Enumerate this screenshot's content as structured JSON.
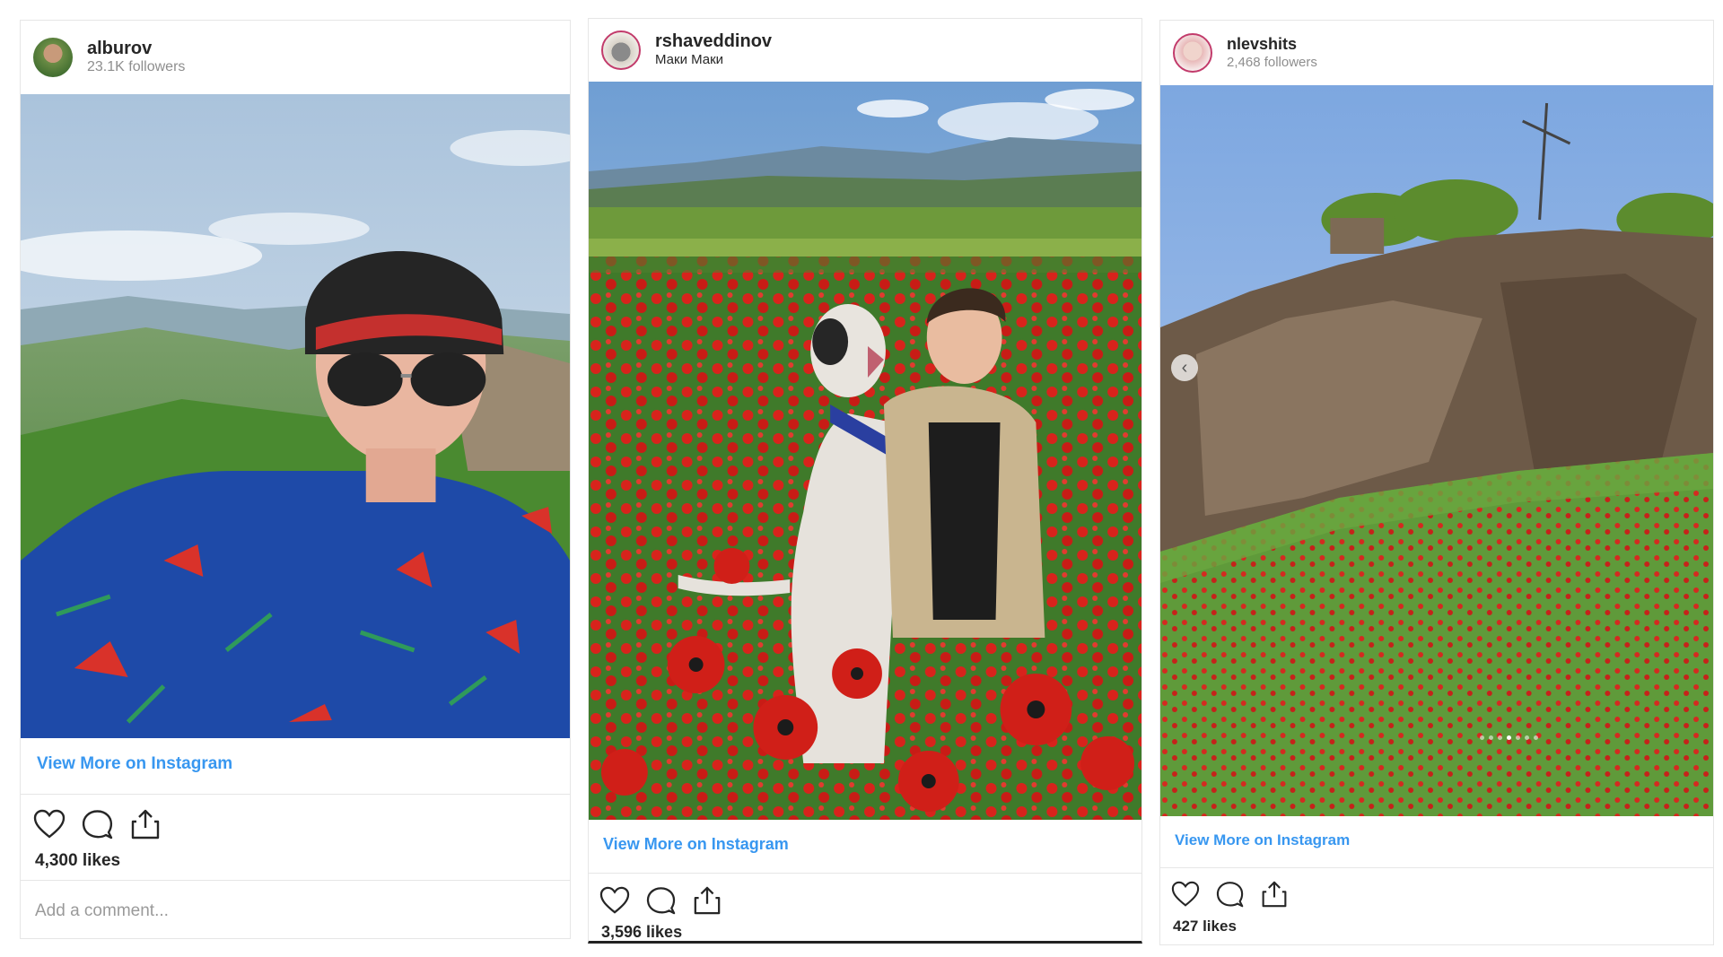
{
  "posts": [
    {
      "username": "alburov",
      "subline": "23.1K followers",
      "view_more": "View More on Instagram",
      "likes": "4,300 likes",
      "comment_placeholder": "Add a comment..."
    },
    {
      "username": "rshaveddinov",
      "subline": "Маки Маки",
      "view_more": "View More on Instagram",
      "likes": "3,596 likes"
    },
    {
      "username": "nlevshits",
      "subline": "2,468 followers",
      "view_more": "View More on Instagram",
      "likes": "427 likes",
      "carousel": {
        "total": 7,
        "active": 4
      }
    }
  ],
  "icons": [
    "heart-icon",
    "comment-icon",
    "share-icon",
    "chevron-left-icon"
  ],
  "colors": {
    "link": "#3897f0",
    "text": "#262626",
    "muted": "#8e8e8e",
    "border": "#e6e6e6"
  }
}
